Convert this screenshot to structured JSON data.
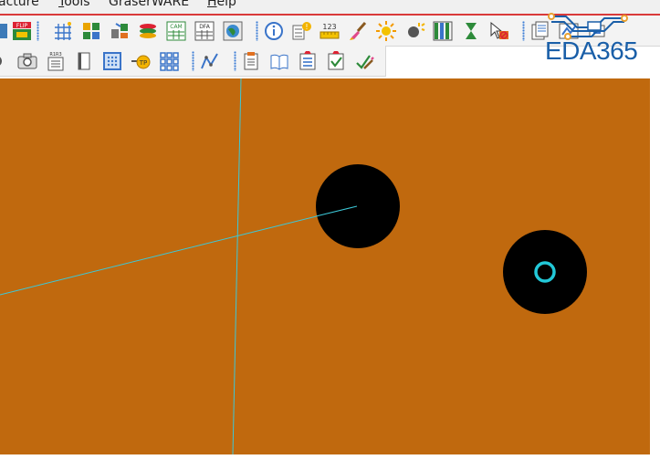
{
  "menubar": {
    "items": [
      {
        "label_pre": "",
        "label_acc": "",
        "label_post": "acture"
      },
      {
        "label_pre": "",
        "label_acc": "T",
        "label_post": "ools"
      },
      {
        "label_pre": "GraserWARE",
        "label_acc": "",
        "label_post": ""
      },
      {
        "label_pre": "",
        "label_acc": "H",
        "label_post": "elp"
      }
    ]
  },
  "toolbar1": {
    "icons": [
      "layer-icon",
      "flip-icon",
      "grid-icon",
      "color-blocks-icon",
      "component-move-icon",
      "layer-stack-icon",
      "cam-icon",
      "dfa-icon",
      "globe-icon",
      "info-icon",
      "properties-icon",
      "measure-icon",
      "brush-icon",
      "sun-icon",
      "dim-sun-icon",
      "bars-icon",
      "hourglass-icon",
      "no-cursor-icon",
      "documents-icon",
      "net-icon",
      "component-icon"
    ],
    "texts": {
      "flip": "FLIP",
      "cam": "CAM",
      "dfa": "DFA",
      "measure": "123"
    }
  },
  "toolbar2": {
    "icons": [
      "partial-icon",
      "camera-icon",
      "rev-icon",
      "page-icon",
      "dots-grid-icon",
      "tp-icon",
      "matrix-icon",
      "route-icon",
      "notes-icon",
      "book-icon",
      "checklist-icon",
      "check-icon",
      "edit-check-icon"
    ],
    "texts": {
      "rev": "R1R3",
      "tp": "TP"
    }
  },
  "logo": {
    "text": "EDA365",
    "color": "#1a5fa8"
  },
  "canvas": {
    "background": "#c0690e",
    "trace_color": "#3cc8d8",
    "pad_color": "#000000",
    "drill_color": "#22c8d8"
  }
}
